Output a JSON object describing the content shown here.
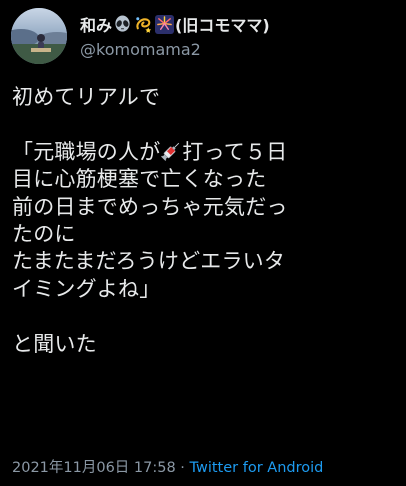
{
  "author": {
    "display_name_text": "和み",
    "display_name_suffix": "(旧コモママ)",
    "emojis": [
      "alien-emoji",
      "dizzy-emoji",
      "fireworks-emoji"
    ],
    "handle": "@komomama2"
  },
  "tweet": {
    "lines": [
      "初めてリアルで",
      "",
      "「元職場の人が",
      "打って５日",
      "目に心筋梗塞で亡くなった",
      "前の日までめっちゃ元気だっ",
      "たのに",
      "たまたまだろうけどエラいタ",
      "イミングよね」",
      "",
      "と聞いた"
    ],
    "inline_emoji": "syringe-emoji"
  },
  "meta": {
    "timestamp": "2021年11月06日 17:58",
    "separator": " · ",
    "source": "Twitter for Android"
  },
  "colors": {
    "background": "#000000",
    "text": "#e7e9ea",
    "secondary": "#8b98a5",
    "link": "#1d9bf0"
  }
}
